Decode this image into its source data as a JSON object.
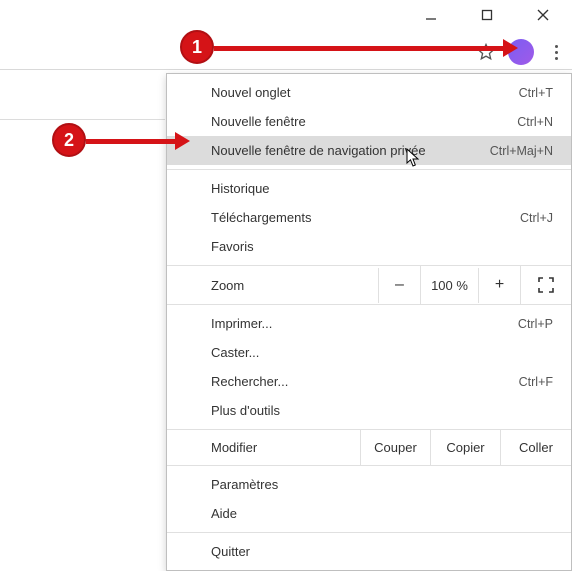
{
  "annotations": {
    "badge1": "1",
    "badge2": "2"
  },
  "menu": {
    "new_tab": {
      "label": "Nouvel onglet",
      "shortcut": "Ctrl+T"
    },
    "new_window": {
      "label": "Nouvelle fenêtre",
      "shortcut": "Ctrl+N"
    },
    "new_incognito": {
      "label": "Nouvelle fenêtre de navigation privée",
      "shortcut": "Ctrl+Maj+N"
    },
    "history": {
      "label": "Historique"
    },
    "downloads": {
      "label": "Téléchargements",
      "shortcut": "Ctrl+J"
    },
    "bookmarks": {
      "label": "Favoris"
    },
    "zoom": {
      "label": "Zoom",
      "minus": "–",
      "value": "100 %",
      "plus": "+"
    },
    "print": {
      "label": "Imprimer...",
      "shortcut": "Ctrl+P"
    },
    "cast": {
      "label": "Caster..."
    },
    "find": {
      "label": "Rechercher...",
      "shortcut": "Ctrl+F"
    },
    "more_tools": {
      "label": "Plus d'outils"
    },
    "edit": {
      "label": "Modifier",
      "cut": "Couper",
      "copy": "Copier",
      "paste": "Coller"
    },
    "settings": {
      "label": "Paramètres"
    },
    "help": {
      "label": "Aide"
    },
    "exit": {
      "label": "Quitter"
    }
  }
}
